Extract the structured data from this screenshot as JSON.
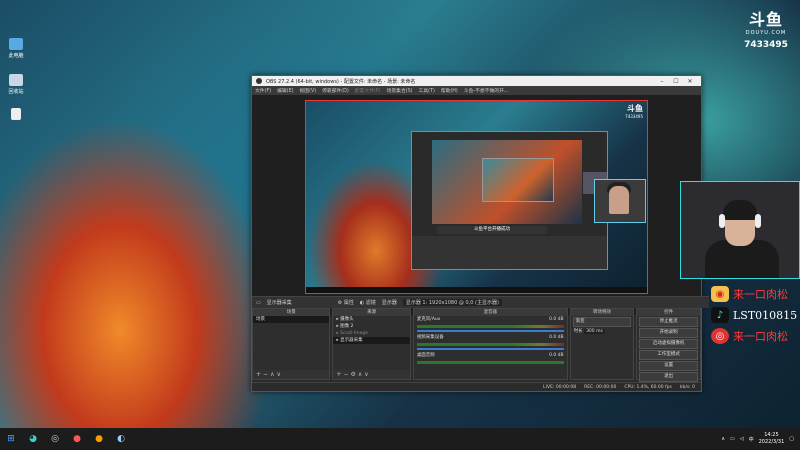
{
  "desktop": {
    "icons": [
      {
        "label": "此电脑"
      },
      {
        "label": "回收站"
      },
      {
        "label": ""
      }
    ]
  },
  "douyu": {
    "logo": "斗鱼",
    "sub": "DOUYU.COM",
    "room_id": "7433495"
  },
  "obs": {
    "title": "OBS 27.2.4 (64-bit, windows) - 配置文件: 未命名 - 场景: 未命名",
    "menu": [
      "文件(F)",
      "编辑(E)",
      "视图(V)",
      "停靠部件(D)",
      "配置文件(P)",
      "场景集合(S)",
      "工具(T)",
      "帮助(H)",
      "斗鱼-不想不做的开..."
    ],
    "canvas": {
      "logo": "斗鱼",
      "room_id": "7433495",
      "toast": "斗鱼平台开播成功"
    },
    "dockbar": {
      "source_name": "显示器采集",
      "properties": "属性",
      "filters": "滤镜",
      "display_label": "显示器",
      "display_value": "显示器 1: 1920x1080 @ 0,0 (主显示器)"
    },
    "scenes": {
      "header": "场景",
      "items": [
        "场景"
      ]
    },
    "sources": {
      "header": "来源",
      "items": [
        "摄像头",
        "图像 2",
        "Scroll Image",
        "显示器采集"
      ]
    },
    "mixer": {
      "header": "混音器",
      "channels": [
        {
          "name": "麦克风/Aux",
          "db": "0.0 dB"
        },
        {
          "name": "视频采集设备",
          "db": "0.0 dB"
        },
        {
          "name": "桌面音频",
          "db": "0.0 dB"
        }
      ]
    },
    "transitions": {
      "header": "转场特效",
      "type": "渐变",
      "duration_label": "时长",
      "duration": "300 ms"
    },
    "controls": {
      "header": "控件",
      "buttons": [
        "停止推流",
        "开始录制",
        "启动虚拟摄像机",
        "工作室模式",
        "设置",
        "退出"
      ]
    },
    "status": {
      "live": "LIVE: 00:00:08",
      "rec": "REC: 00:00:00",
      "cpu": "CPU: 1.4%, 60.00 fps",
      "kbps": "kb/s: 0"
    }
  },
  "overlay": {
    "weibo_text": "来一口肉松",
    "douyin_text": "LST010815",
    "netease_text": "来一口肉松"
  },
  "taskbar": {
    "time": "14:25",
    "date": "2022/3/31"
  }
}
